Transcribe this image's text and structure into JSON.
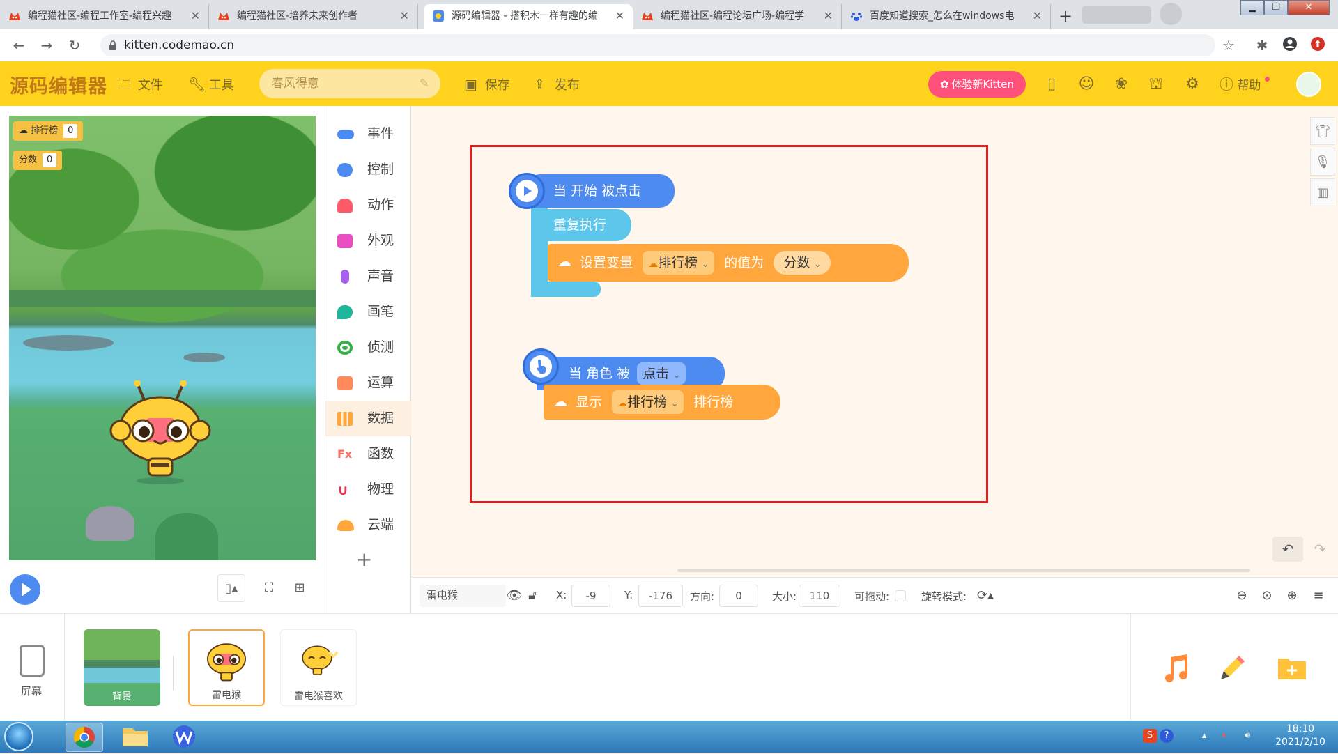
{
  "browser": {
    "tabs": [
      {
        "title": "编程猫社区-编程工作室-编程兴趣",
        "active": false
      },
      {
        "title": "编程猫社区-培养未来创作者",
        "active": false
      },
      {
        "title": "源码编辑器 - 搭积木一样有趣的编",
        "active": true
      },
      {
        "title": "编程猫社区-编程论坛广场-编程学",
        "active": false
      },
      {
        "title": "百度知道搜索_怎么在windows电",
        "active": false
      }
    ],
    "url": "kitten.codemao.cn"
  },
  "header": {
    "logo": "源码编辑器",
    "file_label": "文件",
    "tools_label": "工具",
    "project_name": "春风得意",
    "save_label": "保存",
    "publish_label": "发布",
    "try_kitten_label": "体验新Kitten",
    "help_label": "帮助"
  },
  "stage": {
    "monitors": [
      {
        "label": "排行榜",
        "value": "0"
      },
      {
        "label": "分数",
        "value": "0"
      }
    ]
  },
  "categories": [
    {
      "label": "事件",
      "color": "#4d8bf0"
    },
    {
      "label": "控制",
      "color": "#4d8bf0"
    },
    {
      "label": "动作",
      "color": "#ff5a6a"
    },
    {
      "label": "外观",
      "color": "#e84fc0"
    },
    {
      "label": "声音",
      "color": "#a461ef"
    },
    {
      "label": "画笔",
      "color": "#1fb69c"
    },
    {
      "label": "侦测",
      "color": "#37b24a"
    },
    {
      "label": "运算",
      "color": "#ff8a5c"
    },
    {
      "label": "数据",
      "color": "#ffa63c"
    },
    {
      "label": "函数",
      "color": "#ff6a5c"
    },
    {
      "label": "物理",
      "color": "#e8314a"
    },
    {
      "label": "云端",
      "color": "#ffa63c"
    }
  ],
  "script1": {
    "hat_label": "当 开始 被点击",
    "repeat_label": "重复执行",
    "set_label": "设置变量",
    "var_name": "排行榜",
    "value_label": "的值为",
    "value_var": "分数"
  },
  "script2": {
    "hat_label": "当 角色 被",
    "event_option": "点击",
    "show_label": "显示",
    "var_name": "排行榜",
    "suffix": "排行榜"
  },
  "properties": {
    "sprite_name": "雷电猴",
    "x_label": "X:",
    "x": "-9",
    "y_label": "Y:",
    "y": "-176",
    "dir_label": "方向:",
    "direction": "0",
    "size_label": "大小:",
    "size": "110",
    "draggable_label": "可拖动:",
    "rotation_label": "旋转模式:"
  },
  "sprites": {
    "screen_label": "屏幕",
    "items": [
      {
        "name": "背景"
      },
      {
        "name": "雷电猴"
      },
      {
        "name": "雷电猴喜欢"
      }
    ]
  },
  "taskbar": {
    "time": "18:10",
    "date": "2021/2/10"
  }
}
